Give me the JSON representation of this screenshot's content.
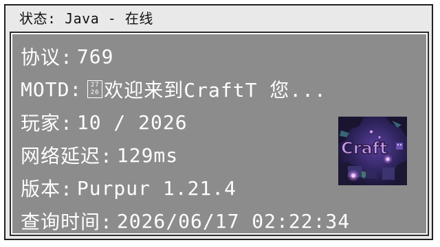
{
  "title": {
    "text": "状态: Java - 在线"
  },
  "rows": [
    {
      "label": "协议:",
      "value": "769"
    },
    {
      "label": "MOTD:",
      "glyph_top": "27",
      "glyph_bottom": "26",
      "value": "欢迎来到CraftT 您..."
    },
    {
      "label": "玩家:",
      "value": "10 / 2026"
    },
    {
      "label": "网络延迟:",
      "value": "129ms"
    },
    {
      "label": "版本:",
      "value": "Purpur 1.21.4"
    },
    {
      "label": "查询时间:",
      "value": "2026/06/17 02:22:34"
    }
  ],
  "server_icon": {
    "name": "server-logo",
    "text": "Craft",
    "colors": {
      "bg_dark": "#1b1633",
      "bg_mid": "#3a2b6e",
      "glow": "#b86ad9",
      "text_fill": "#c79be6",
      "text_stroke": "#2a1747",
      "moss": "#3f7a8a"
    }
  },
  "colors": {
    "frame_bg": "#e9e9e9",
    "panel_bg": "#8c8c8c",
    "text": "#ffffff",
    "title_text": "#111111"
  }
}
